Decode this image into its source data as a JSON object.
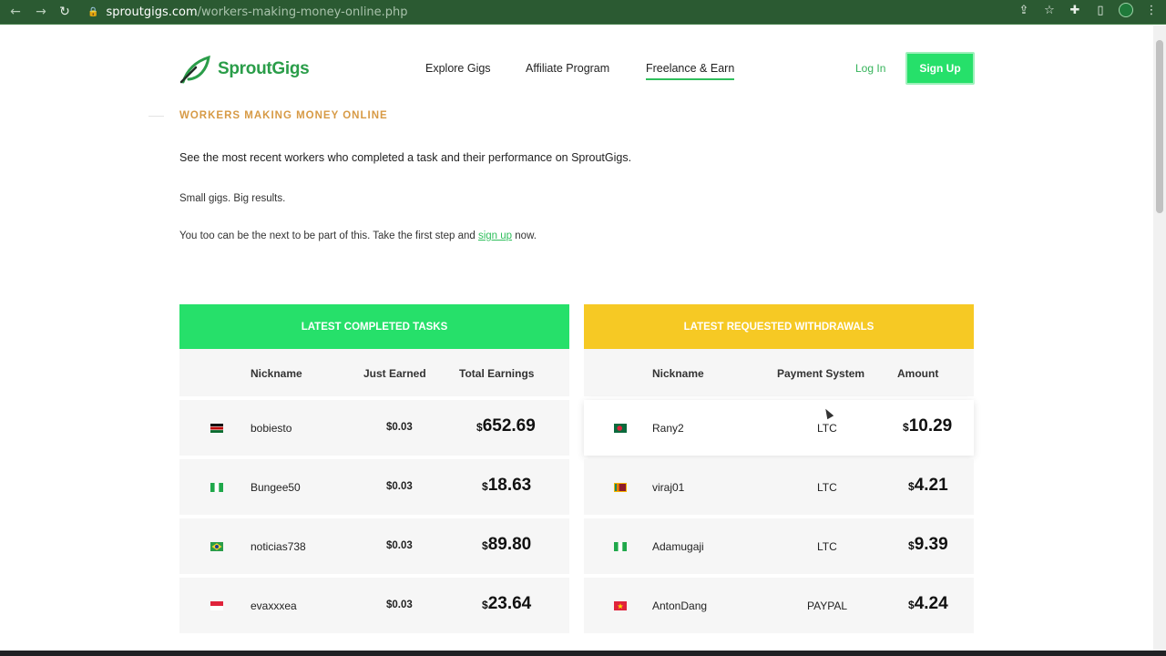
{
  "browser": {
    "url_host": "sproutgigs.com",
    "url_path": "/workers-making-money-online.php",
    "icons": [
      "back-icon",
      "forward-icon",
      "reload-icon",
      "lock-icon",
      "share-icon",
      "star-icon",
      "extensions-icon",
      "sidepanel-icon",
      "profile-icon",
      "menu-icon"
    ]
  },
  "header": {
    "logo_text": "SproutGigs",
    "nav": [
      "Explore Gigs",
      "Affiliate Program",
      "Freelance & Earn"
    ],
    "login": "Log In",
    "signup": "Sign Up"
  },
  "intro": {
    "eyebrow": "WORKERS MAKING MONEY ONLINE",
    "lead": "See the most recent workers who completed a task and their performance on SproutGigs.",
    "tagline": "Small gigs. Big results.",
    "cta_before": "You too can be the next to be part of this. Take the first step and ",
    "cta_link": "sign up",
    "cta_after": " now."
  },
  "completed": {
    "title": "LATEST COMPLETED TASKS",
    "headers": [
      "Nickname",
      "Just Earned",
      "Total Earnings"
    ],
    "rows": [
      {
        "flag": "Kenya",
        "nickname": "bobiesto",
        "just": "$0.03",
        "total": "652.69"
      },
      {
        "flag": "Nigeria",
        "nickname": "Bungee50",
        "just": "$0.03",
        "total": "18.63"
      },
      {
        "flag": "Brazil",
        "nickname": "noticias738",
        "just": "$0.03",
        "total": "89.80"
      },
      {
        "flag": "Indonesia",
        "nickname": "evaxxxea",
        "just": "$0.03",
        "total": "23.64"
      }
    ]
  },
  "withdrawals": {
    "title": "LATEST REQUESTED WITHDRAWALS",
    "headers": [
      "Nickname",
      "Payment System",
      "Amount"
    ],
    "rows": [
      {
        "flag": "Bangladesh",
        "nickname": "Rany2",
        "system": "LTC",
        "amount": "10.29"
      },
      {
        "flag": "Sri Lanka",
        "nickname": "viraj01",
        "system": "LTC",
        "amount": "4.21"
      },
      {
        "flag": "Nigeria",
        "nickname": "Adamugaji",
        "system": "LTC",
        "amount": "9.39"
      },
      {
        "flag": "Vietnam",
        "nickname": "AntonDang",
        "system": "PAYPAL",
        "amount": "4.24"
      }
    ]
  },
  "currency_symbol": "$",
  "colors": {
    "brand_green": "#26e06a",
    "withdraw_yellow": "#f6c924",
    "eyebrow": "#d79a45",
    "chrome": "#2b5a32"
  }
}
